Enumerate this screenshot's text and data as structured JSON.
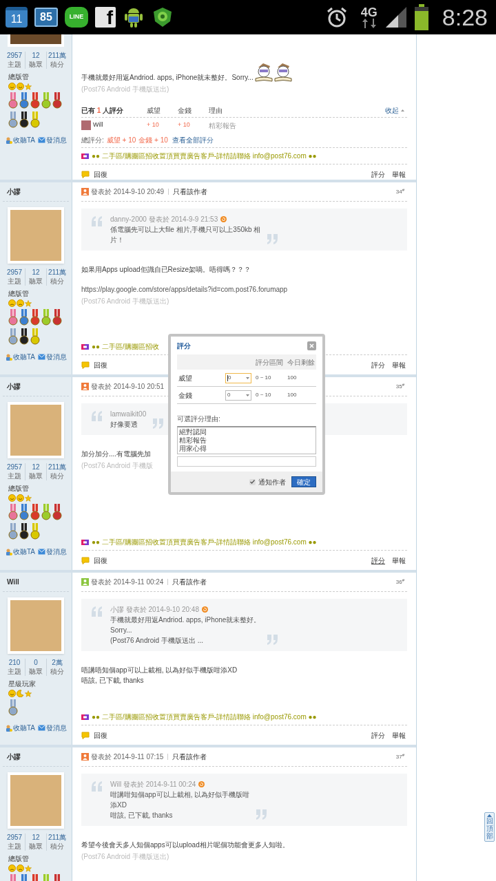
{
  "status_bar": {
    "notifications": [
      {
        "kind": "calendar",
        "text": "11"
      },
      {
        "kind": "counter",
        "text": "85"
      },
      {
        "kind": "chat",
        "text": "LINE"
      },
      {
        "kind": "social",
        "text": "f"
      },
      {
        "kind": "robot"
      },
      {
        "kind": "shield"
      }
    ],
    "network": "4G",
    "time": "8:28"
  },
  "posts": [
    {
      "kind": "continued",
      "stats": [
        {
          "value": "2957",
          "label": "主題"
        },
        {
          "value": "12",
          "label": "聽眾"
        },
        {
          "value": "211萬",
          "label": "積分"
        }
      ],
      "rank": "總版管",
      "rank_icons": [
        {
          "kind": "smiley"
        },
        {
          "kind": "smiley"
        },
        {
          "kind": "star"
        }
      ],
      "medals": [
        {
          "color": "#e8749a"
        },
        {
          "color": "#3b7fd0"
        },
        {
          "color": "#d93a2b"
        },
        {
          "color": "#9ccc2a"
        },
        {
          "color": "#c83232"
        },
        {
          "color": "#8fa8c8"
        },
        {
          "color": "#222222"
        },
        {
          "color": "#d8c800"
        }
      ],
      "follow": "收聽TA",
      "message": "發消息",
      "body": [
        {
          "kind": "text",
          "lines": [
            "手機就最好用返Andriod. apps,  iPhone就未整好。Sorry..."
          ],
          "emoticons": [
            {
              "kind": "reader"
            },
            {
              "kind": "reader"
            }
          ]
        }
      ],
      "signature": "(Post76 Android 手機版送出)",
      "rating": {
        "title_before": "已有",
        "count": "1",
        "title_after": "人評分",
        "columns": [
          "威望",
          "金錢",
          "理由"
        ],
        "collapse": "收起",
        "rows": [
          {
            "user": "Will",
            "prestige": "+ 10",
            "money": "+ 10",
            "reason": "精彩報告"
          }
        ],
        "total_label": "總評分:",
        "totals": [
          "威望 + 10",
          "金錢 + 10"
        ],
        "view_all": "查看全部評分"
      },
      "ad": "●● 二手區/購團區招收置頂買賣廣告客戶-詳情請聯絡 info@post76.com ●●",
      "reply": "回復",
      "actions": [
        {
          "label": "評分",
          "underlined": false
        },
        {
          "label": "舉報",
          "underlined": false
        }
      ]
    },
    {
      "kind": "full",
      "author": "小謬",
      "stats": [
        {
          "value": "2957",
          "label": "主題"
        },
        {
          "value": "12",
          "label": "聽眾"
        },
        {
          "value": "211萬",
          "label": "積分"
        }
      ],
      "rank": "總版管",
      "rank_icons": [
        {
          "kind": "frown"
        },
        {
          "kind": "frown"
        },
        {
          "kind": "star"
        }
      ],
      "medals": [
        {
          "color": "#e8749a"
        },
        {
          "color": "#3b7fd0"
        },
        {
          "color": "#d93a2b"
        },
        {
          "color": "#9ccc2a"
        },
        {
          "color": "#c83232"
        },
        {
          "color": "#8fa8c8"
        },
        {
          "color": "#222222"
        },
        {
          "color": "#d8c800"
        }
      ],
      "follow": "收聽TA",
      "message": "發消息",
      "color": "#f07a3a",
      "header": {
        "posted": "發表於 2014-9-10 20:49",
        "author_only": "只看該作者",
        "floor": "34",
        "floor_suffix": "#"
      },
      "quote": {
        "author_line": "danny-2000 發表於 2014-9-9 21:53",
        "lines": [
          "係電腦先可以上大file 相片,手機只可以上350kb 相",
          "片！"
        ]
      },
      "body": [
        {
          "kind": "text",
          "lines": [
            "如果用Apps upload佢識自已Resize架喎。唔得嗎？？？"
          ]
        },
        {
          "kind": "link",
          "lines": [
            "https://play.google.com/store/apps/details?id=com.post76.forumapp"
          ]
        }
      ],
      "signature": "(Post76 Android 手機版送出)",
      "ad": "●● 二手區/購團區招收",
      "reply": "回復",
      "actions": [
        {
          "label": "評分",
          "underlined": false
        },
        {
          "label": "舉報",
          "underlined": false
        }
      ]
    },
    {
      "kind": "full",
      "author": "小謬",
      "stats": [
        {
          "value": "2957",
          "label": "主題"
        },
        {
          "value": "12",
          "label": "聽眾"
        },
        {
          "value": "211萬",
          "label": "積分"
        }
      ],
      "rank": "總版管",
      "rank_icons": [
        {
          "kind": "smiley"
        },
        {
          "kind": "smiley"
        },
        {
          "kind": "star"
        }
      ],
      "medals": [
        {
          "color": "#e8749a"
        },
        {
          "color": "#3b7fd0"
        },
        {
          "color": "#d93a2b"
        },
        {
          "color": "#9ccc2a"
        },
        {
          "color": "#c83232"
        },
        {
          "color": "#8fa8c8"
        },
        {
          "color": "#222222"
        },
        {
          "color": "#d8c800"
        }
      ],
      "follow": "收聽TA",
      "message": "發消息",
      "color": "#f07a3a",
      "header": {
        "posted": "發表於 2014-9-10 20:51",
        "floor": "35",
        "floor_suffix": "#"
      },
      "quote": {
        "author_line": "lamwaikit00",
        "lines": [
          "好像要透"
        ]
      },
      "body": [
        {
          "kind": "text",
          "lines": [
            "加分加分....有電腦先加"
          ]
        }
      ],
      "signature": "(Post76 Android 手機版",
      "ad": "●● 二手區/購團區招收置頂買賣廣告客戶-詳情請聯絡 info@post76.com ●●",
      "reply": "回復",
      "actions": [
        {
          "label": "評分",
          "underlined": true
        },
        {
          "label": "舉報",
          "underlined": false
        }
      ]
    },
    {
      "kind": "full",
      "author": "Will",
      "stats": [
        {
          "value": "210",
          "label": "主題"
        },
        {
          "value": "0",
          "label": "聽眾"
        },
        {
          "value": "2萬",
          "label": "積分"
        }
      ],
      "rank": "星級玩家",
      "rank_icons": [
        {
          "kind": "smiley"
        },
        {
          "kind": "moon"
        },
        {
          "kind": "star"
        }
      ],
      "medals": [
        {
          "color": "#8fa8c8"
        }
      ],
      "follow": "收聽TA",
      "message": "發消息",
      "color": "#8cc63f",
      "header": {
        "posted": "發表於 2014-9-11 00:24",
        "author_only": "只看該作者",
        "floor": "36",
        "floor_suffix": "#"
      },
      "quote": {
        "author_line": "小謬 發表於 2014-9-10 20:48",
        "lines": [
          "手機就最好用返Andriod. apps,  iPhone就未整好。",
          "Sorry...",
          "(Post76 Android 手機版送出 ..."
        ]
      },
      "body": [
        {
          "kind": "text",
          "lines": [
            "唔講唔知個app可以上載相, 以為好似手機版咁添XD",
            "唔該, 已下載, thanks"
          ]
        }
      ],
      "ad": "●● 二手區/購團區招收置頂買賣廣告客戶-詳情請聯絡 info@post76.com ●●",
      "reply": "回復",
      "actions": [
        {
          "label": "評分",
          "underlined": false
        },
        {
          "label": "舉報",
          "underlined": false
        }
      ]
    },
    {
      "kind": "full",
      "author": "小謬",
      "stats": [
        {
          "value": "2957",
          "label": "主題"
        },
        {
          "value": "12",
          "label": "聽眾"
        },
        {
          "value": "211萬",
          "label": "積分"
        }
      ],
      "rank": "總版管",
      "rank_icons": [
        {
          "kind": "frown"
        },
        {
          "kind": "frown"
        },
        {
          "kind": "star"
        }
      ],
      "medals": [
        {
          "color": "#e8749a"
        },
        {
          "color": "#3b7fd0"
        },
        {
          "color": "#d93a2b"
        },
        {
          "color": "#9ccc2a"
        },
        {
          "color": "#c83232"
        }
      ],
      "color": "#f07a3a",
      "header": {
        "posted": "發表於 2014-9-11 07:15",
        "author_only": "只看該作者",
        "floor": "37",
        "floor_suffix": "#"
      },
      "quote": {
        "author_line": "Will 發表於 2014-9-11 00:24",
        "lines": [
          "咁講咁知個app可以上載相, 以為好似手機版咁",
          "添XD",
          "咁該, 已下載, thanks"
        ]
      },
      "body": [
        {
          "kind": "text",
          "lines": [
            "希望今後會天多人知個apps可以upload相片呢個功能會更多人知啦。"
          ]
        }
      ],
      "signature": "(Post76 Android 手機版送出)"
    }
  ],
  "rating_dialog": {
    "title": "評分",
    "columns": [
      "評分區間",
      "今日剩餘"
    ],
    "rows": [
      {
        "label": "威望",
        "value": "0",
        "focused": true,
        "range": "0 ~ 10",
        "remaining": "100"
      },
      {
        "label": "金錢",
        "value": "0",
        "focused": false,
        "range": "0 ~ 10",
        "remaining": "100"
      }
    ],
    "reasons_label": "可選評分理由:",
    "reasons": [
      "絕對認同",
      "精彩報告",
      "用家心得"
    ],
    "notify": {
      "label": "通知作者",
      "checked": true
    },
    "confirm": "確定"
  },
  "back_to_top": "回頂部"
}
